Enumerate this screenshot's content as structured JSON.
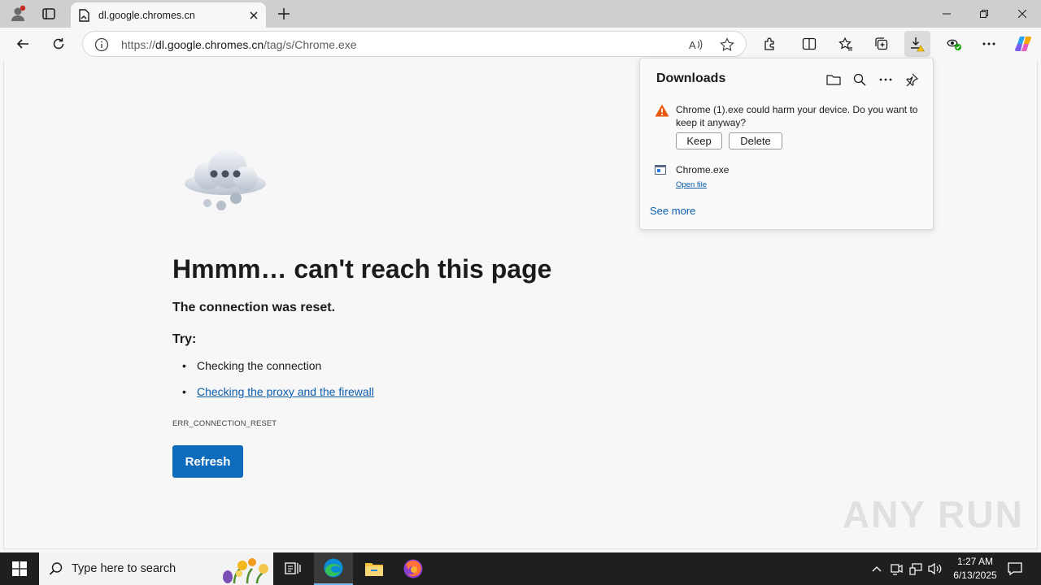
{
  "tab": {
    "title": "dl.google.chromes.cn"
  },
  "address": {
    "url_prefix": "https://",
    "url_host": "dl.google.chromes.cn",
    "url_path": "/tag/s/Chrome.exe"
  },
  "error": {
    "title": "Hmmm… can't reach this page",
    "subtitle": "The connection was reset.",
    "try_label": "Try:",
    "suggestions": [
      "Checking the connection",
      "Checking the proxy and the firewall"
    ],
    "code": "ERR_CONNECTION_RESET",
    "refresh_label": "Refresh"
  },
  "downloads": {
    "title": "Downloads",
    "warning_text": "Chrome (1).exe could harm your device. Do you want to keep it anyway?",
    "keep_label": "Keep",
    "delete_label": "Delete",
    "file_name": "Chrome.exe",
    "open_file_label": "Open file",
    "see_more_label": "See more"
  },
  "taskbar": {
    "search_placeholder": "Type here to search",
    "time": "1:27 AM",
    "date": "6/13/2025"
  },
  "watermark": "ANY RUN",
  "colors": {
    "accent": "#0f6cbd",
    "link": "#0b5cad",
    "warning": "#e8590c",
    "taskbar": "#1f1f1f"
  }
}
